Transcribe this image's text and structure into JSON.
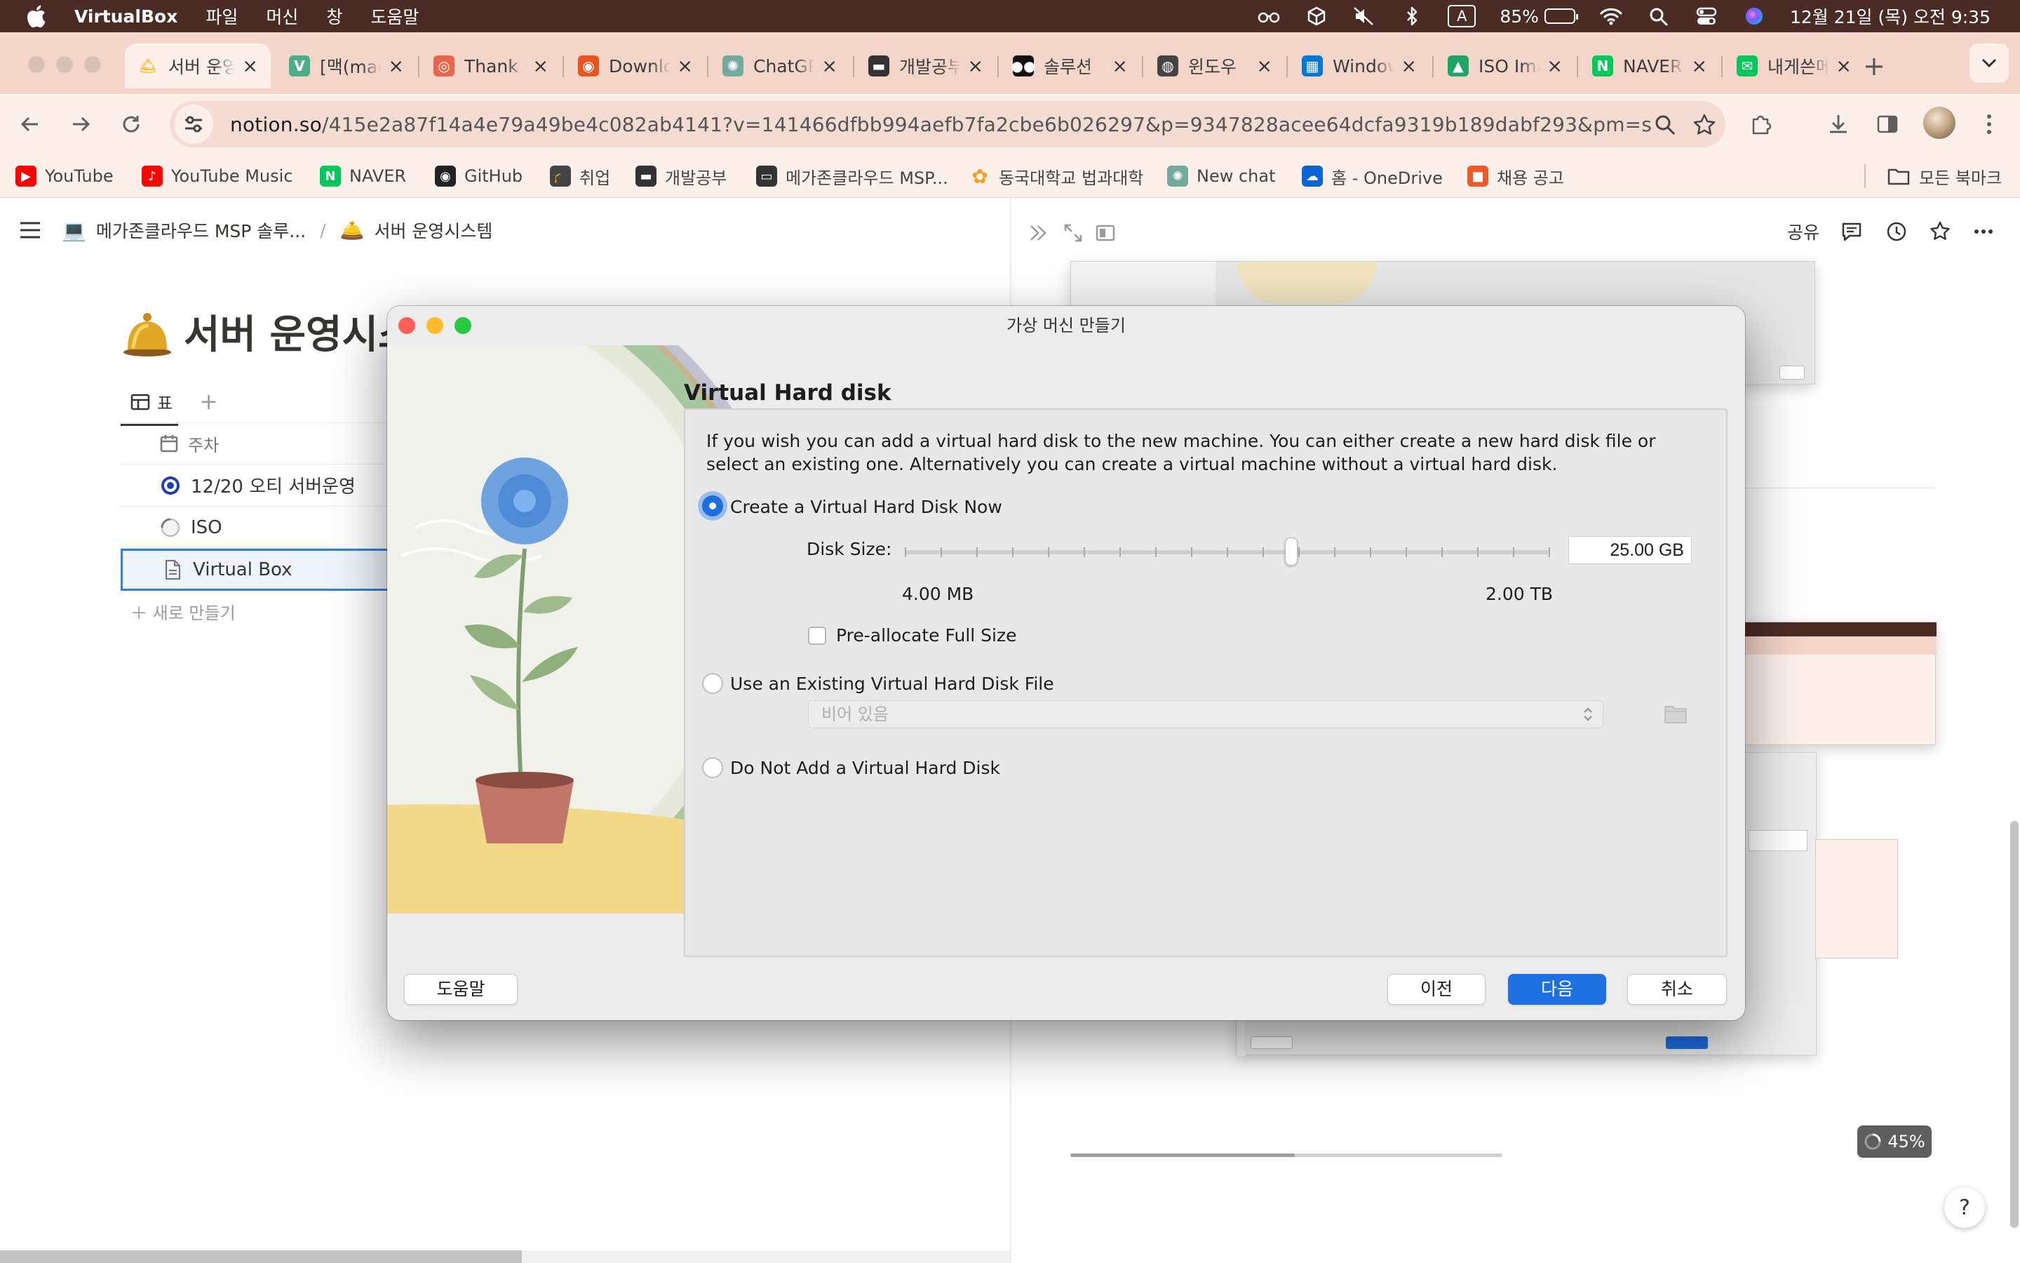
{
  "menubar": {
    "app_name": "VirtualBox",
    "menus": [
      "파일",
      "머신",
      "창",
      "도움말"
    ],
    "keyboard_input": "A",
    "battery_percent": "85%",
    "battery_level": 0.85,
    "datetime": "12월 21일 (목) 오전 9:35",
    "status_icons": [
      "glasses-icon",
      "box-icon",
      "mute-icon",
      "bluetooth-icon",
      "keyboard-input-icon",
      "battery-icon",
      "wifi-icon",
      "spotlight-search-icon",
      "control-center-icon",
      "siri-icon"
    ]
  },
  "tabs": [
    {
      "title": "서버 운영시스템",
      "favicon": "bell-icon",
      "active": true,
      "color": "#f5c542"
    },
    {
      "title": "[맥(macOS)",
      "favicon": "v-icon",
      "color": "#4caf8a"
    },
    {
      "title": "Thank you",
      "favicon": "target-icon",
      "color": "#e8664d"
    },
    {
      "title": "Download",
      "favicon": "ubuntu-icon",
      "color": "#e95420"
    },
    {
      "title": "ChatGPT",
      "favicon": "chatgpt-icon",
      "color": "#74aa9c"
    },
    {
      "title": "개발공부",
      "favicon": "monitor-icon",
      "color": "#333333"
    },
    {
      "title": "솔루션",
      "favicon": "medium-icon",
      "color": "#111111"
    },
    {
      "title": "윈도우",
      "favicon": "globe-icon",
      "color": "#444444"
    },
    {
      "title": "Windows",
      "favicon": "windows-icon",
      "color": "#0078d4"
    },
    {
      "title": "ISO Image",
      "favicon": "google-drive-icon",
      "color": "#1fa463"
    },
    {
      "title": "NAVER",
      "favicon": "naver-icon",
      "color": "#03c75a"
    },
    {
      "title": "내게쓴메일",
      "favicon": "mail-icon",
      "color": "#03c75a"
    }
  ],
  "toolbar": {
    "url_domain": "notion.so",
    "url_path": "/415e2a87f14a4e79a49be4c082ab4141?v=141466dfbb994aefb7fa2cbe6b026297&p=9347828acee64dcfa9319b189dabf293&pm=s"
  },
  "bookmarks": [
    {
      "label": "YouTube",
      "icon": "youtube-icon",
      "color": "#ff0000"
    },
    {
      "label": "YouTube Music",
      "icon": "youtube-music-icon",
      "color": "#ff0000"
    },
    {
      "label": "NAVER",
      "icon": "naver-icon",
      "color": "#03c75a"
    },
    {
      "label": "GitHub",
      "icon": "github-icon",
      "color": "#222222"
    },
    {
      "label": "취업",
      "icon": "graduation-cap-icon",
      "color": "#444444"
    },
    {
      "label": "개발공부",
      "icon": "monitor-icon",
      "color": "#333333"
    },
    {
      "label": "메가존클라우드 MSP...",
      "icon": "laptop-icon",
      "color": "#333333"
    },
    {
      "label": "동국대학교 법과대학",
      "icon": "flower-icon",
      "color": "#f0a020"
    },
    {
      "label": "New chat",
      "icon": "chatgpt-icon",
      "color": "#74aa9c"
    },
    {
      "label": "홈 - OneDrive",
      "icon": "onedrive-icon",
      "color": "#0a64d6"
    },
    {
      "label": "채용 공고",
      "icon": "job-icon",
      "color": "#f05a28"
    }
  ],
  "all_bookmarks_label": "모든 북마크",
  "notion": {
    "breadcrumb_parent": "메가존클라우드 MSP 솔루...",
    "breadcrumb_current": "서버 운영시스템",
    "page_title": "서버 운영시스",
    "view_tab": "표",
    "column_header": "주차",
    "rows": [
      {
        "label": "12/20 오티 서버운영",
        "icon": "target-icon"
      },
      {
        "label": "ISO",
        "icon": "loading-circle-icon"
      },
      {
        "label": "Virtual Box",
        "icon": "page-icon"
      }
    ],
    "new_row": "새로 만들기",
    "share": "공유",
    "progress_text": "45%",
    "help": "?"
  },
  "dialog": {
    "title": "가상 머신 만들기",
    "section_title": "Virtual Hard disk",
    "description": "If you wish you can add a virtual hard disk to the new machine. You can either create a new hard disk file or select an existing one. Alternatively you can create a virtual machine without a virtual hard disk.",
    "option_create": "Create a Virtual Hard Disk Now",
    "disk_size_label": "Disk Size:",
    "disk_size_value": "25.00 GB",
    "slider_position": 0.6,
    "slider_min": "4.00 MB",
    "slider_max": "2.00 TB",
    "preallocate_label": "Pre-allocate Full Size",
    "option_existing": "Use an Existing Virtual Hard Disk File",
    "file_placeholder": "비어 있음",
    "option_none": "Do Not Add a Virtual Hard Disk",
    "selected_option": "create",
    "buttons": {
      "help": "도움말",
      "back": "이전",
      "next": "다음",
      "cancel": "취소"
    }
  }
}
